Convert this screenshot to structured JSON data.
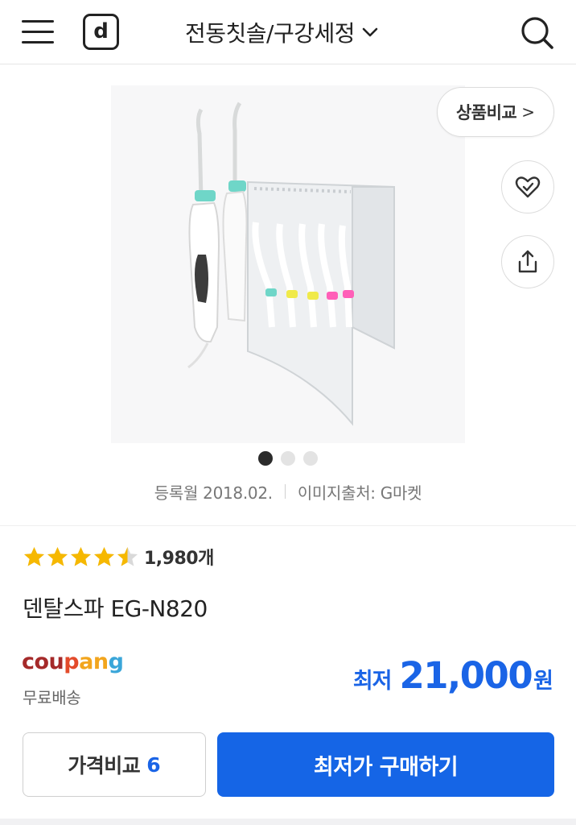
{
  "header": {
    "logo_letter": "d",
    "category": "전동칫솔/구강세정",
    "icons": [
      "menu-icon",
      "search-icon",
      "chevron-down-icon"
    ]
  },
  "gallery": {
    "compare_label": "상품비교",
    "compare_chevron": ">",
    "slide_count": 3,
    "active_slide": 1,
    "icons": [
      "heart-check-icon",
      "share-icon"
    ]
  },
  "meta": {
    "registered": "등록월 2018.02.",
    "image_source": "이미지출처: G마켓"
  },
  "rating": {
    "score_stars": 4.5,
    "max_stars": 5,
    "count": "1,980개",
    "star_color": "#f6b800"
  },
  "product": {
    "name": "덴탈스파 EG-N820"
  },
  "seller": {
    "logo_parts": [
      "cou",
      "p",
      "an",
      "g"
    ],
    "logo_colors": [
      "#a52a2a",
      "#e34b2b",
      "#f2a51d",
      "#3aa6d9"
    ],
    "shipping": "무료배송"
  },
  "price": {
    "prefix": "최저",
    "amount": "21,000",
    "unit": "원",
    "color": "#1a64e6"
  },
  "buttons": {
    "compare_label": "가격비교",
    "compare_count": "6",
    "buy_label": "최저가 구매하기",
    "buy_color": "#1565e6"
  }
}
